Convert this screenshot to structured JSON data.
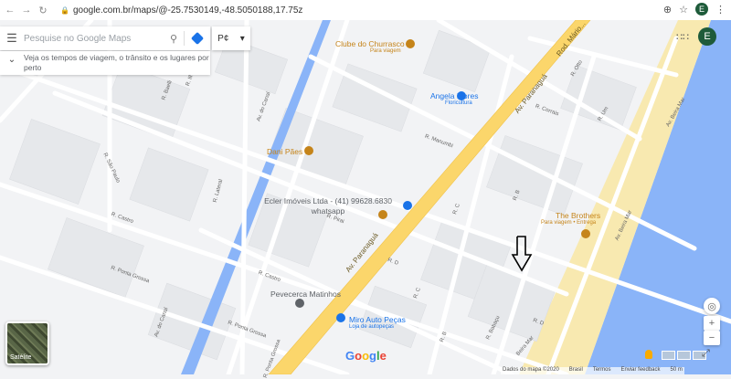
{
  "browser": {
    "url": "google.com.br/maps/@-25.7530149,-48.5050188,17.75z",
    "profile_initial": "E"
  },
  "search": {
    "placeholder": "Pesquise no Google Maps",
    "language_button": "P¢"
  },
  "info_card": {
    "text": "Veja os tempos de viagem, o trânsito e os lugares por perto"
  },
  "account": {
    "initial": "E"
  },
  "pois": [
    {
      "name": "Clube do Churrasco",
      "sub": "Para viagem",
      "color": "#c5841a"
    },
    {
      "name": "Angela Flores",
      "sub": "Floricultura",
      "color": "#1a73e8"
    },
    {
      "name": "Dani Pães",
      "sub": "",
      "color": "#c5841a"
    },
    {
      "name": "Ecler Imóveis Ltda - (41) 99628.6830 whatsapp",
      "sub": "",
      "color": "#5f6368"
    },
    {
      "name": "The Brothers",
      "sub": "Para viagem • Entrega",
      "color": "#c5841a"
    },
    {
      "name": "Pevecerca Matinhos",
      "sub": "",
      "color": "#5f6368"
    },
    {
      "name": "Miro Auto Peças",
      "sub": "Loja de autopeças",
      "color": "#1a73e8"
    }
  ],
  "streets": [
    "R. Baelli",
    "R. Ilha",
    "Av. do Canal",
    "R. São Paulo",
    "R. Castro",
    "R. Lateral",
    "R. Ponta Grossa",
    "R. Castro",
    "R. Ponta Grossa",
    "Av. do Canal",
    "R. Ponta Grossa",
    "R. Manumbi",
    "R. Corrais",
    "R. Otto",
    "R. Um",
    "Av. Beira Mar",
    "R. Pirai",
    "R. D",
    "R. C",
    "R. B",
    "R. C",
    "R. B",
    "R. D",
    "R. Babaçu",
    "Beira Mar",
    "Av. Beira Mar",
    "Av. Paranaguá",
    "Av. Paranaguá",
    "Rod. Mário..."
  ],
  "map_branding": {
    "logo": "Google",
    "satellite_label": "Satélite"
  },
  "attribution": {
    "map_data": "Dados do mapa ©2020",
    "country": "Brasil",
    "terms": "Termos",
    "feedback": "Enviar feedback",
    "scale": "50 m"
  },
  "colors": {
    "land": "#f2f3f5",
    "block": "#e6e8eb",
    "road": "#ffffff",
    "highway": "#fbd66b",
    "water": "#8ab4f8",
    "beach": "#f8e9b0",
    "google_blue": "#4285f4",
    "google_red": "#ea4335",
    "google_yellow": "#fbbc05",
    "google_green": "#34a853"
  }
}
